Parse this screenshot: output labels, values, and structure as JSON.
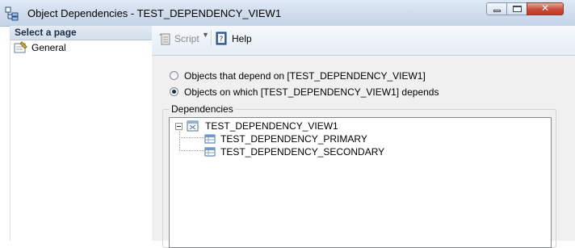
{
  "window": {
    "title": "Object Dependencies - TEST_DEPENDENCY_VIEW1",
    "close_glyph": "✕",
    "icon": "dependency-tree-icon"
  },
  "sidebar": {
    "header": "Select a page",
    "items": [
      {
        "label": "General",
        "icon": "page-settings-icon"
      }
    ]
  },
  "toolbar": {
    "script_label": "Script",
    "script_arrow": "▼",
    "help_label": "Help"
  },
  "options": {
    "depend_on_label": "Objects that depend on [TEST_DEPENDENCY_VIEW1]",
    "depends_label": "Objects on which [TEST_DEPENDENCY_VIEW1] depends",
    "selected": "depends"
  },
  "dependencies": {
    "title": "Dependencies",
    "root": {
      "label": "TEST_DEPENDENCY_VIEW1",
      "icon": "view-icon",
      "expanded": true
    },
    "children": [
      {
        "label": "TEST_DEPENDENCY_PRIMARY",
        "icon": "table-icon"
      },
      {
        "label": "TEST_DEPENDENCY_SECONDARY",
        "icon": "table-icon"
      }
    ]
  },
  "colors": {
    "titlebar": "#cfdcec",
    "close_button": "#c94a36",
    "panel": "#f0f0f0"
  }
}
